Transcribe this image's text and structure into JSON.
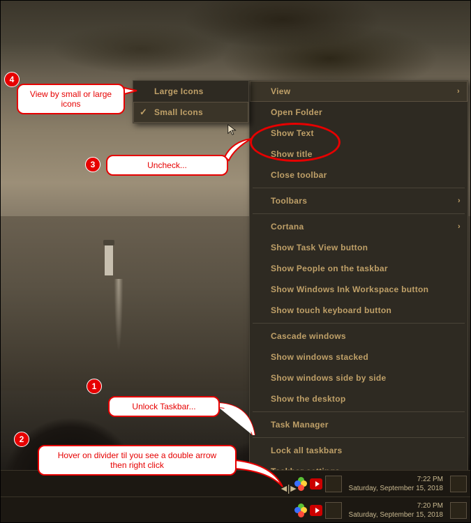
{
  "submenu": {
    "items": [
      {
        "label": "Large Icons",
        "checked": false
      },
      {
        "label": "Small Icons",
        "checked": true
      }
    ]
  },
  "mainmenu": {
    "groups": [
      [
        {
          "label": "View",
          "arrow": true
        },
        {
          "label": "Open Folder"
        },
        {
          "label": "Show Text"
        },
        {
          "label": "Show title"
        },
        {
          "label": "Close toolbar"
        }
      ],
      [
        {
          "label": "Toolbars",
          "arrow": true
        }
      ],
      [
        {
          "label": "Cortana",
          "arrow": true
        },
        {
          "label": "Show Task View button"
        },
        {
          "label": "Show People on the taskbar"
        },
        {
          "label": "Show Windows Ink Workspace button"
        },
        {
          "label": "Show touch keyboard button"
        }
      ],
      [
        {
          "label": "Cascade windows"
        },
        {
          "label": "Show windows stacked"
        },
        {
          "label": "Show windows side by side"
        },
        {
          "label": "Show the desktop"
        }
      ],
      [
        {
          "label": "Task Manager"
        }
      ],
      [
        {
          "label": "Lock all taskbars"
        },
        {
          "label": "Taskbar settings",
          "gear": true
        }
      ]
    ]
  },
  "annotations": {
    "n1": "1",
    "n2": "2",
    "n3": "3",
    "n4": "4",
    "box1": "Unlock Taskbar...",
    "box2": "Hover on divider til you see a double arrow then right click",
    "box3": "Uncheck...",
    "box4": "View by small or large icons"
  },
  "taskbar1": {
    "time": "7:22 PM",
    "date": "Saturday, September 15, 2018"
  },
  "taskbar2": {
    "time": "7:20 PM",
    "date": "Saturday, September 15, 2018"
  }
}
